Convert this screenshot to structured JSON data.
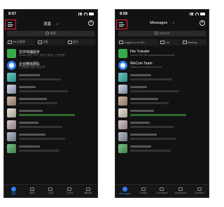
{
  "left": {
    "time": "8:57",
    "title": "消息",
    "search_placeholder": "搜索",
    "quick": [
      "Win已登录",
      "日程",
      "会议"
    ],
    "chats": [
      {
        "name": "文件传输助手",
        "preview": "Scribe 我们 PDF 文件 已成功 上传完成",
        "time": ""
      },
      {
        "name": "企业微信团队",
        "preview": "企业微信 团队 欢迎 你",
        "time": ""
      }
    ],
    "tabs": [
      "消息",
      "邮件",
      "文档",
      "工作台",
      "通讯录"
    ]
  },
  "right": {
    "time": "8:58",
    "title": "Messages",
    "search_placeholder": "Search",
    "quick": [
      "Logged in on Win",
      "Cal",
      "Meeting"
    ],
    "chats": [
      {
        "name": "File Transfer",
        "preview": "Scribe PDF file uploaded successfully",
        "time": ""
      },
      {
        "name": "WeCom Team",
        "preview": "Welcome to WeCom Team",
        "time": ""
      }
    ],
    "tabs": [
      "Messages",
      "Emails",
      "Document",
      "Workspace",
      "Contacts"
    ]
  },
  "colors": {
    "highlight": "#e8232f",
    "accent": "#2f7ff5",
    "file_transfer": "#3aa94c",
    "wecom_team": "#2f7ff5"
  }
}
